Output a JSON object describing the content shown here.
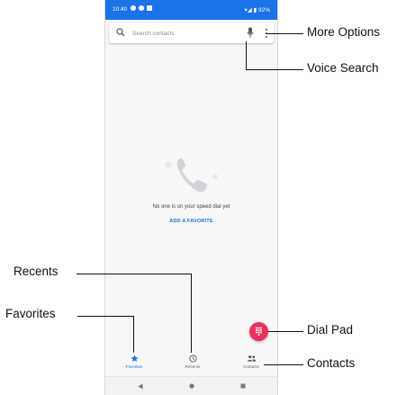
{
  "statusbar": {
    "time": "10:40",
    "right": "▾◢ ▮ 92%"
  },
  "search": {
    "placeholder": "Search contacts"
  },
  "empty_state": {
    "message": "No one is on your speed dial yet",
    "action": "ADD A FAVORITE"
  },
  "bottom_nav": [
    {
      "label": "Favorites",
      "active": true
    },
    {
      "label": "Recents",
      "active": false
    },
    {
      "label": "Contacts",
      "active": false
    }
  ],
  "callouts": {
    "more_options": "More Options",
    "voice_search": "Voice Search",
    "recents": "Recents",
    "favorites": "Favorites",
    "dial_pad": "Dial Pad",
    "contacts": "Contacts"
  },
  "colors": {
    "accent": "#1a73e8",
    "fab": "#e8315f"
  }
}
